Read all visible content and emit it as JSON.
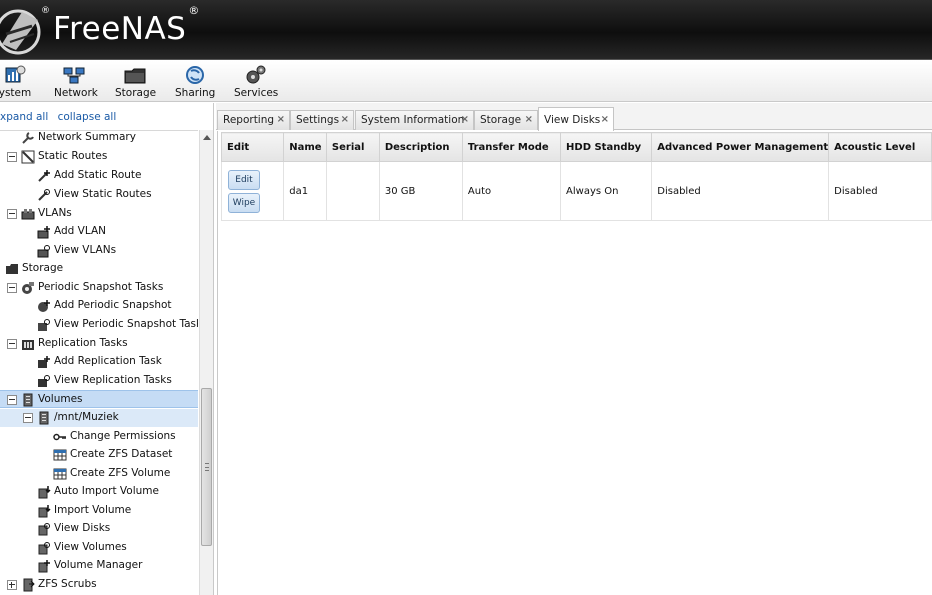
{
  "app": {
    "brand": "FreeNAS",
    "reg": "®"
  },
  "toolbar": {
    "items": [
      {
        "label": "System",
        "display": "ystem"
      },
      {
        "label": "Network",
        "display": "Network"
      },
      {
        "label": "Storage",
        "display": "Storage"
      },
      {
        "label": "Sharing",
        "display": "Sharing"
      },
      {
        "label": "Services",
        "display": "Services"
      }
    ]
  },
  "sidebar": {
    "expand_all": "xpand all",
    "collapse_all": "collapse all",
    "tree": [
      {
        "label": "Network Summary"
      },
      {
        "label": "Static Routes"
      },
      {
        "label": "Add Static Route"
      },
      {
        "label": "View Static Routes"
      },
      {
        "label": "VLANs"
      },
      {
        "label": "Add VLAN"
      },
      {
        "label": "View VLANs"
      },
      {
        "label": "Storage"
      },
      {
        "label": "Periodic Snapshot Tasks"
      },
      {
        "label": "Add Periodic Snapshot"
      },
      {
        "label": "View Periodic Snapshot Tasks"
      },
      {
        "label": "Replication Tasks"
      },
      {
        "label": "Add Replication Task"
      },
      {
        "label": "View Replication Tasks"
      },
      {
        "label": "Volumes"
      },
      {
        "label": "/mnt/Muziek"
      },
      {
        "label": "Change Permissions"
      },
      {
        "label": "Create ZFS Dataset"
      },
      {
        "label": "Create ZFS Volume"
      },
      {
        "label": "Auto Import Volume"
      },
      {
        "label": "Import Volume"
      },
      {
        "label": "View Disks"
      },
      {
        "label": "View Volumes"
      },
      {
        "label": "Volume Manager"
      },
      {
        "label": "ZFS Scrubs"
      }
    ]
  },
  "tabs": [
    {
      "label": "Reporting"
    },
    {
      "label": "Settings"
    },
    {
      "label": "System Information"
    },
    {
      "label": "Storage"
    },
    {
      "label": "View Disks",
      "active": true
    }
  ],
  "tab_close": "×",
  "disks_table": {
    "columns": [
      "Edit",
      "Name",
      "Serial",
      "Description",
      "Transfer Mode",
      "HDD Standby",
      "Advanced Power Management",
      "Acoustic Level"
    ],
    "rows": [
      {
        "edit_label": "Edit",
        "wipe_label": "Wipe",
        "name": "da1",
        "serial": "",
        "description": "30 GB",
        "transfer_mode": "Auto",
        "hdd_standby": "Always On",
        "apm": "Disabled",
        "acoustic": "Disabled"
      }
    ]
  }
}
